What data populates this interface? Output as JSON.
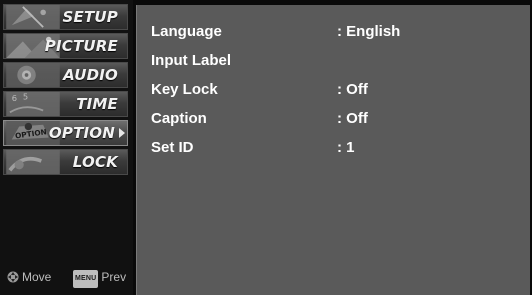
{
  "sidebar": {
    "items": [
      {
        "label": "SETUP",
        "active": false
      },
      {
        "label": "PICTURE",
        "active": false
      },
      {
        "label": "AUDIO",
        "active": false
      },
      {
        "label": "TIME",
        "active": false
      },
      {
        "label": "OPTION",
        "active": true
      },
      {
        "label": "LOCK",
        "active": false
      }
    ],
    "hints": {
      "move_label": "Move",
      "menu_key": "MENU",
      "prev_label": "Prev"
    }
  },
  "panel": {
    "rows": [
      {
        "label": "Language",
        "value": ": English"
      },
      {
        "label": "Input Label",
        "value": ""
      },
      {
        "label": "Key Lock",
        "value": ": Off"
      },
      {
        "label": "Caption",
        "value": ": Off"
      },
      {
        "label": "Set ID",
        "value": ": 1"
      }
    ]
  },
  "colors": {
    "panel_bg": "#5a5a5a",
    "text": "#ffffff"
  }
}
